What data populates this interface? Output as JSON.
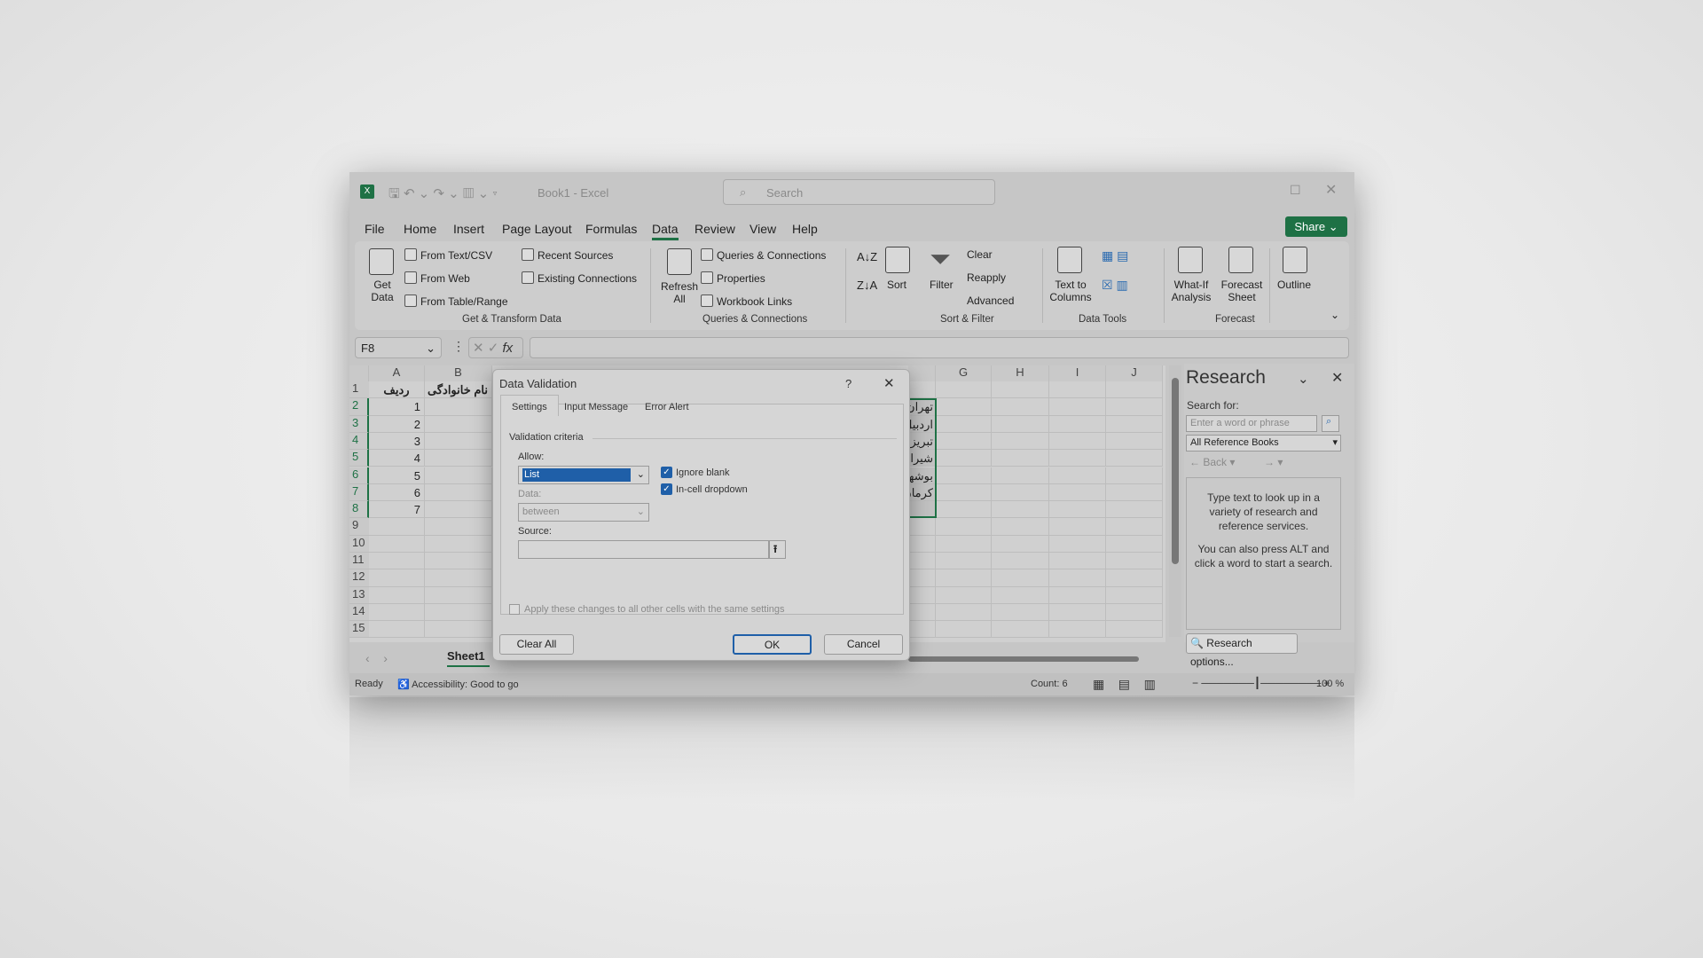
{
  "titlebar": {
    "title": "Book1  -  Excel",
    "search_placeholder": "Search"
  },
  "menu": [
    "File",
    "Home",
    "Insert",
    "Page Layout",
    "Formulas",
    "Data",
    "Review",
    "View",
    "Help"
  ],
  "share": "Share",
  "ribbon": {
    "get_data": "Get Data",
    "from_text_csv": "From Text/CSV",
    "from_web": "From Web",
    "from_table_range": "From Table/Range",
    "recent_sources": "Recent Sources",
    "existing_connections": "Existing Connections",
    "group_get": "Get & Transform Data",
    "refresh_all": "Refresh All",
    "queries_connections": "Queries & Connections",
    "properties": "Properties",
    "workbook_links": "Workbook Links",
    "group_queries": "Queries & Connections",
    "sort": "Sort",
    "filter": "Filter",
    "clear": "Clear",
    "reapply": "Reapply",
    "advanced": "Advanced",
    "group_sort": "Sort & Filter",
    "text_to_columns": "Text to Columns",
    "group_tools": "Data Tools",
    "what_if": "What-If Analysis",
    "forecast_sheet": "Forecast Sheet",
    "group_forecast": "Forecast",
    "outline": "Outline"
  },
  "formula_bar": {
    "name_box": "F8",
    "fx": "fx",
    "value": ""
  },
  "columns": [
    "A",
    "B",
    "G",
    "H",
    "I",
    "J"
  ],
  "rows": [
    "1",
    "2",
    "3",
    "4",
    "5",
    "6",
    "7",
    "8",
    "9",
    "10",
    "11",
    "12",
    "13",
    "14",
    "15"
  ],
  "col_a": [
    "ردیف",
    "1",
    "2",
    "3",
    "4",
    "5",
    "6",
    "7"
  ],
  "col_b": [
    "نام خانوادگی"
  ],
  "col_f": [
    "",
    "تهران",
    "اردبیل",
    "تبریز",
    "شیراز",
    "بوشهر",
    "کرمان"
  ],
  "dialog": {
    "title": "Data Validation",
    "help": "?",
    "tabs": [
      "Settings",
      "Input Message",
      "Error Alert"
    ],
    "criteria": "Validation criteria",
    "allow_label": "Allow:",
    "allow_value": "List",
    "data_label": "Data:",
    "data_value": "between",
    "source_label": "Source:",
    "source_value": "",
    "ignore_blank": "Ignore blank",
    "ignore_blank_checked": true,
    "in_cell": "In-cell dropdown",
    "in_cell_checked": true,
    "apply_all": "Apply these changes to all other cells with the same settings",
    "apply_all_checked": false,
    "clear_all": "Clear All",
    "ok": "OK",
    "cancel": "Cancel"
  },
  "sheet_tab": "Sheet1",
  "research": {
    "title": "Research",
    "search_for": "Search for:",
    "placeholder": "Enter a word or phrase",
    "books": "All Reference Books",
    "back": "Back",
    "help1": "Type text to look up in a variety of research and reference services.",
    "help2": "You can also press ALT and click a word to start a search.",
    "options": "Research options..."
  },
  "status": {
    "ready": "Ready",
    "accessibility": "Accessibility: Good to go",
    "count": "Count: 6",
    "zoom": "100 %"
  },
  "colors": {
    "excel_green": "#1e7145",
    "selection_blue": "#1f5fa8"
  }
}
